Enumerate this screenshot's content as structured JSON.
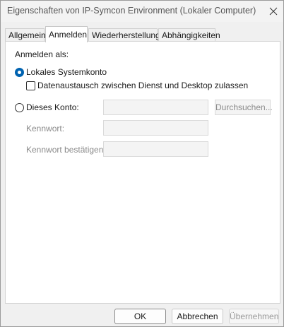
{
  "window": {
    "title": "Eigenschaften von IP-Symcon Environment (Lokaler Computer)"
  },
  "tabs": [
    {
      "label": "Allgemein",
      "active": false
    },
    {
      "label": "Anmelden",
      "active": true
    },
    {
      "label": "Wiederherstellung",
      "active": false
    },
    {
      "label": "Abhängigkeiten",
      "active": false
    }
  ],
  "logon": {
    "heading": "Anmelden als:",
    "local_system_label": "Lokales Systemkonto",
    "local_system_selected": true,
    "desktop_interaction_label": "Datenaustausch zwischen Dienst und Desktop zulassen",
    "desktop_interaction_checked": false,
    "this_account_label": "Dieses Konto:",
    "this_account_selected": false,
    "account_value": "",
    "browse_label": "Durchsuchen...",
    "password_label": "Kennwort:",
    "password_value": "",
    "confirm_password_label": "Kennwort bestätigen:",
    "confirm_password_value": ""
  },
  "footer": {
    "ok_label": "OK",
    "cancel_label": "Abbrechen",
    "apply_label": "Übernehmen"
  },
  "colors": {
    "accent": "#0063b1",
    "disabled_text": "#8a8a8a"
  }
}
